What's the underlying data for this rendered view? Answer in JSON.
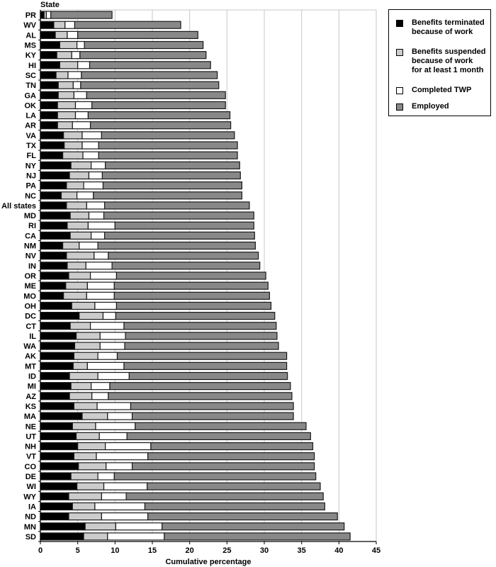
{
  "chart_data": {
    "type": "bar",
    "orientation": "horizontal",
    "stacked": true,
    "title": "",
    "ylabel": "State",
    "xlabel": "Cumulative percentage",
    "xlim": [
      0,
      45
    ],
    "xticks": [
      0,
      5,
      10,
      15,
      20,
      25,
      30,
      35,
      40,
      45
    ],
    "grid": true,
    "legend_position": "top-right",
    "categories": [
      "PR",
      "WV",
      "AL",
      "MS",
      "KY",
      "HI",
      "SC",
      "TN",
      "GA",
      "OK",
      "LA",
      "AR",
      "VA",
      "TX",
      "FL",
      "NY",
      "NJ",
      "PA",
      "NC",
      "All states",
      "MD",
      "RI",
      "CA",
      "NM",
      "NV",
      "IN",
      "OR",
      "ME",
      "MO",
      "OH",
      "DC",
      "CT",
      "IL",
      "WA",
      "AK",
      "MT",
      "ID",
      "MI",
      "AZ",
      "KS",
      "MA",
      "NE",
      "UT",
      "NH",
      "VT",
      "CO",
      "DE",
      "WI",
      "WY",
      "IA",
      "ND",
      "MN",
      "SD"
    ],
    "series": [
      {
        "name": "Benefits terminated because of work",
        "color": "#000000",
        "values": [
          0.5,
          1.8,
          2.0,
          2.6,
          2.2,
          2.6,
          2.1,
          2.4,
          2.4,
          2.3,
          2.3,
          2.3,
          3.1,
          3.2,
          3.0,
          4.1,
          3.9,
          3.5,
          2.8,
          3.5,
          4.0,
          3.6,
          4.0,
          3.0,
          3.5,
          3.6,
          3.8,
          3.4,
          3.1,
          4.2,
          5.2,
          4.0,
          4.8,
          4.6,
          4.5,
          4.4,
          3.9,
          4.1,
          3.9,
          4.5,
          5.6,
          4.3,
          4.8,
          5.0,
          4.5,
          5.1,
          4.1,
          4.9,
          3.8,
          4.3,
          3.8,
          6.0,
          5.8
        ]
      },
      {
        "name": "Benefits suspended because of work for at least 1 month",
        "color": "#cccccc",
        "values": [
          0.3,
          1.5,
          1.6,
          2.3,
          2.0,
          2.4,
          1.6,
          2.0,
          2.1,
          2.4,
          2.4,
          2.0,
          2.5,
          2.4,
          2.7,
          2.7,
          2.6,
          2.3,
          2.1,
          2.7,
          2.5,
          2.8,
          2.8,
          2.2,
          3.7,
          2.5,
          2.9,
          2.9,
          3.1,
          3.1,
          3.2,
          2.7,
          3.2,
          3.4,
          3.2,
          1.9,
          3.8,
          2.7,
          3.0,
          3.1,
          3.4,
          3.1,
          3.1,
          3.7,
          3.0,
          3.7,
          3.6,
          3.6,
          4.4,
          3.0,
          4.4,
          4.1,
          3.2
        ]
      },
      {
        "name": "Completed TWP",
        "color": "#ffffff",
        "values": [
          0.6,
          1.3,
          1.4,
          1.0,
          1.1,
          1.6,
          1.8,
          1.0,
          1.7,
          2.2,
          1.7,
          2.4,
          2.6,
          2.2,
          2.1,
          1.9,
          1.8,
          2.6,
          2.2,
          2.4,
          2.0,
          3.6,
          1.8,
          2.5,
          1.9,
          3.5,
          3.5,
          3.6,
          3.7,
          2.9,
          1.7,
          4.5,
          3.4,
          3.3,
          2.6,
          4.9,
          4.2,
          2.5,
          2.2,
          4.5,
          3.3,
          5.3,
          3.7,
          6.1,
          6.9,
          3.5,
          2.2,
          5.8,
          3.3,
          6.7,
          6.2,
          6.2,
          7.6
        ]
      },
      {
        "name": "Employed",
        "color": "#888888",
        "values": [
          8.2,
          14.2,
          16.1,
          15.9,
          16.9,
          16.2,
          18.2,
          18.5,
          18.6,
          17.9,
          19.0,
          18.8,
          17.8,
          18.6,
          18.6,
          18.0,
          18.5,
          18.6,
          19.9,
          19.4,
          20.1,
          18.6,
          20.1,
          21.1,
          20.1,
          19.8,
          20.0,
          20.6,
          20.8,
          20.7,
          21.3,
          20.4,
          20.3,
          20.6,
          22.7,
          21.8,
          21.2,
          24.2,
          24.6,
          21.8,
          21.6,
          22.9,
          24.6,
          21.7,
          22.3,
          24.4,
          27.0,
          23.2,
          26.4,
          24.1,
          25.4,
          24.4,
          24.9
        ]
      }
    ],
    "totals": [
      9.6,
      18.8,
      21.1,
      21.8,
      22.2,
      22.8,
      23.7,
      23.9,
      24.8,
      24.8,
      25.4,
      25.5,
      26.0,
      26.4,
      26.4,
      26.7,
      26.8,
      27.0,
      27.0,
      28.0,
      28.6,
      28.6,
      28.7,
      28.8,
      29.2,
      29.4,
      30.2,
      30.5,
      30.7,
      30.9,
      31.4,
      31.6,
      31.7,
      31.9,
      33.0,
      33.0,
      33.1,
      33.5,
      33.7,
      33.9,
      33.9,
      35.6,
      36.2,
      36.5,
      36.7,
      36.7,
      36.9,
      37.5,
      37.9,
      38.1,
      39.8,
      40.7,
      41.5
    ]
  },
  "legend": {
    "items": [
      {
        "label": "Benefits terminated\nbecause of work",
        "color": "#000000"
      },
      {
        "label": "Benefits suspended\nbecause of work\nfor at least 1 month",
        "color": "#cccccc"
      },
      {
        "label": "Completed TWP",
        "color": "#ffffff"
      },
      {
        "label": "Employed",
        "color": "#888888"
      }
    ]
  }
}
